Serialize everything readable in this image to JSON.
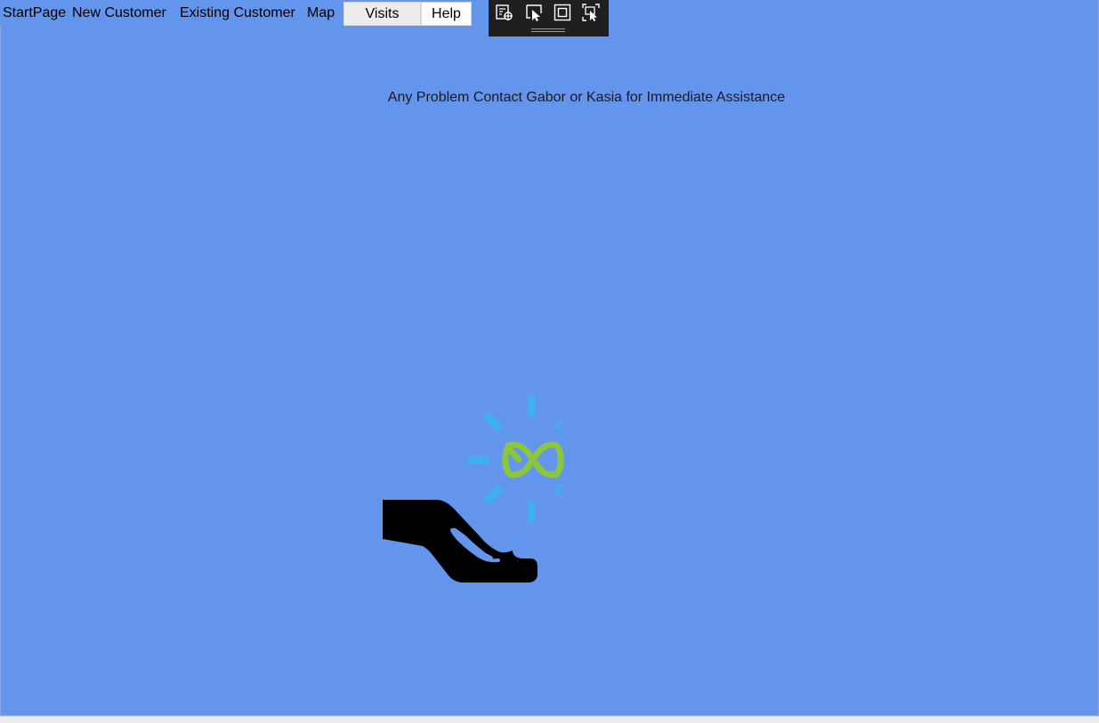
{
  "tabs": [
    {
      "label": "StartPage"
    },
    {
      "label": "New Customer"
    },
    {
      "label": "Existing Customer"
    },
    {
      "label": "Map"
    },
    {
      "label": "Visits"
    },
    {
      "label": "Help",
      "selected": true
    }
  ],
  "debug_toolbar": {
    "icons": [
      "live-visual-tree-icon",
      "select-element-icon",
      "display-layout-adorners-icon",
      "track-focused-element-icon"
    ]
  },
  "main": {
    "support_message": "Any Problem Contact Gabor or Kasia for Immediate Assistance"
  },
  "colors": {
    "background": "#6495ed",
    "infinity_green": "#8cc63f",
    "ray_blue": "#3fb1ee",
    "hand": "#000000",
    "toolbar_bg": "#1f1f1f"
  }
}
